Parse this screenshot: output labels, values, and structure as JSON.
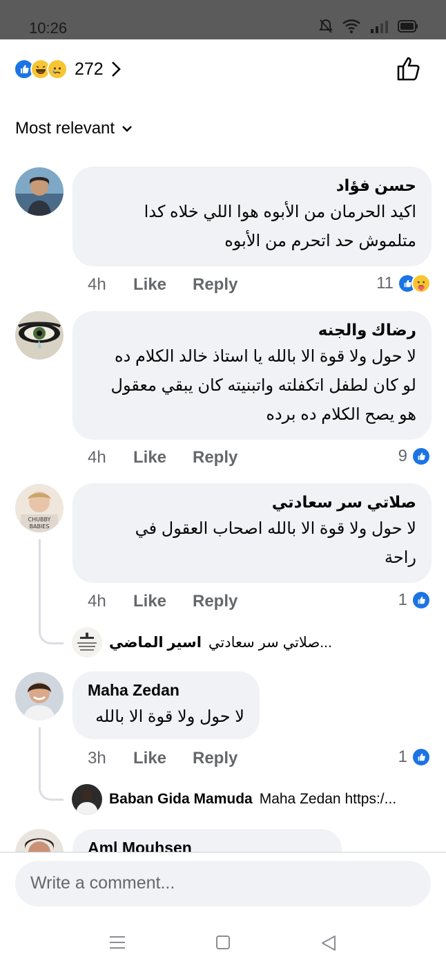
{
  "status": {
    "time": "10:26"
  },
  "reactions": {
    "count": "272"
  },
  "sort": {
    "label": "Most relevant"
  },
  "comments": [
    {
      "author": "حسن فؤاد",
      "lines": [
        "اكيد الحرمان من الأبوه هوا اللي خلاه كدا",
        "متلموش حد اتحرم من الأبوه"
      ],
      "time": "4h",
      "like": "Like",
      "reply": "Reply",
      "reaction_count": "11"
    },
    {
      "author": "رضاك والجنه",
      "lines": [
        "لا حول ولا قوة الا بالله يا استاذ خالد الكلام ده",
        "لو كان لطفل اتكفلته واتبنيته  كان يبقي معقول",
        "هو يصح الكلام ده برده"
      ],
      "time": "4h",
      "like": "Like",
      "reply": "Reply",
      "reaction_count": "9"
    },
    {
      "author": "صلاتي سر سعادتي",
      "lines": [
        "لا حول ولا قوة الا بالله اصحاب العقول في",
        "راحة"
      ],
      "time": "4h",
      "like": "Like",
      "reply": "Reply",
      "reaction_count": "1",
      "reply_preview": {
        "author": "اسير الماضي",
        "text": "صلاتي سر سعادتي..."
      }
    },
    {
      "author": "Maha Zedan",
      "lines": [
        "لا حول ولا قوة الا بالله"
      ],
      "time": "3h",
      "like": "Like",
      "reply": "Reply",
      "reaction_count": "1",
      "reply_preview": {
        "author": "Baban Gida Mamuda",
        "text": "Maha Zedan https:/..."
      }
    },
    {
      "author": "Aml Mouhsen"
    }
  ],
  "composer": {
    "placeholder": "Write a comment..."
  }
}
